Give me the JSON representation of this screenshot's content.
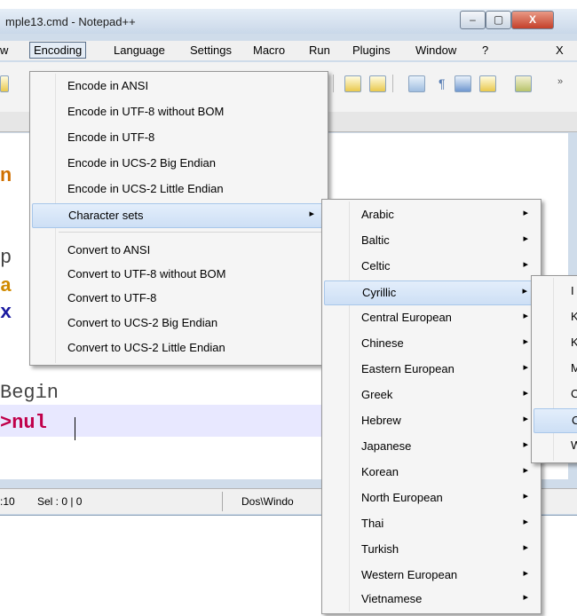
{
  "window": {
    "title": "mple13.cmd - Notepad++",
    "buttons": {
      "minimize": "–",
      "maximize": "▢",
      "close": "X"
    }
  },
  "menubar": {
    "items": [
      "w",
      "Encoding",
      "Language",
      "Settings",
      "Macro",
      "Run",
      "Plugins",
      "Window",
      "?"
    ],
    "close_label": "X"
  },
  "editor": {
    "lines": [
      "n",
      "p",
      "a",
      "x",
      "Begin",
      ">nul"
    ],
    "colors": {
      "keyword": "#e07b00",
      "ident": "#7a1f1f",
      "label": "#1a1aa0",
      "redirect": "#d0004a",
      "plain": "#444444"
    }
  },
  "statusbar": {
    "position": ":10",
    "selection": "Sel : 0 | 0",
    "eol": "Dos\\Windo"
  },
  "encoding_menu": {
    "group1": [
      "Encode in ANSI",
      "Encode in UTF-8 without BOM",
      "Encode in UTF-8",
      "Encode in UCS-2 Big Endian",
      "Encode in UCS-2 Little Endian"
    ],
    "character_sets": "Character sets",
    "group2": [
      "Convert to ANSI",
      "Convert to UTF-8 without BOM",
      "Convert to UTF-8",
      "Convert to UCS-2 Big Endian",
      "Convert to UCS-2 Little Endian"
    ]
  },
  "charset_menu": {
    "items": [
      "Arabic",
      "Baltic",
      "Celtic",
      "Cyrillic",
      "Central European",
      "Chinese",
      "Eastern European",
      "Greek",
      "Hebrew",
      "Japanese",
      "Korean",
      "North European",
      "Thai",
      "Turkish",
      "Western European",
      "Vietnamese"
    ],
    "highlighted": "Cyrillic"
  },
  "cyrillic_menu": {
    "items": [
      "I",
      "K",
      "K",
      "M",
      "C",
      "C",
      "W"
    ],
    "highlighted_index": 5
  },
  "submenu_arrow": "▸"
}
